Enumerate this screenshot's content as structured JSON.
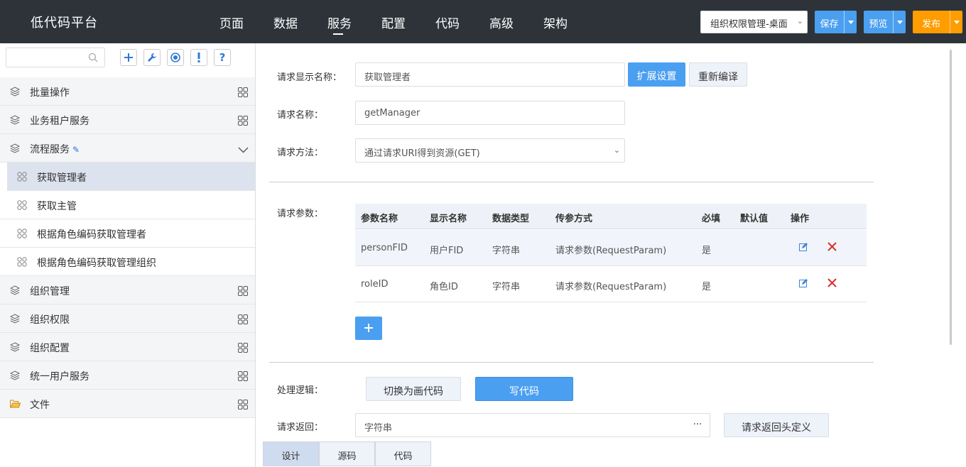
{
  "app": {
    "title": "低代码平台"
  },
  "nav": {
    "items": [
      {
        "label": "页面"
      },
      {
        "label": "数据"
      },
      {
        "label": "服务",
        "active": true
      },
      {
        "label": "配置"
      },
      {
        "label": "代码"
      },
      {
        "label": "高级"
      },
      {
        "label": "架构"
      }
    ]
  },
  "header": {
    "workspace_select": "组织权限管理-桌面",
    "save_label": "保存",
    "preview_label": "预览",
    "publish_label": "发布"
  },
  "sidebar": {
    "search_placeholder": "",
    "tools": [
      {
        "icon": "plus-icon"
      },
      {
        "icon": "wrench-icon"
      },
      {
        "icon": "target-icon"
      },
      {
        "icon": "exclamation-icon"
      },
      {
        "icon": "question-icon"
      }
    ],
    "tree": [
      {
        "label": "批量操作",
        "type": "group"
      },
      {
        "label": "业务租户服务",
        "type": "group"
      },
      {
        "label": "流程服务",
        "type": "group",
        "expanded": true,
        "editable": true
      },
      {
        "label": "获取管理者",
        "type": "child",
        "selected": true
      },
      {
        "label": "获取主管",
        "type": "child"
      },
      {
        "label": "根据角色编码获取管理者",
        "type": "child"
      },
      {
        "label": "根据角色编码获取管理组织",
        "type": "child"
      },
      {
        "label": "组织管理",
        "type": "group"
      },
      {
        "label": "组织权限",
        "type": "group"
      },
      {
        "label": "组织配置",
        "type": "group"
      },
      {
        "label": "统一用户服务",
        "type": "group"
      },
      {
        "label": "文件",
        "type": "folder"
      }
    ]
  },
  "form": {
    "display_name_label": "请求显示名称：",
    "display_name_value": "获取管理者",
    "ext_settings_label": "扩展设置",
    "recompile_label": "重新编译",
    "name_label": "请求名称：",
    "name_value": "getManager",
    "method_label": "请求方法：",
    "method_value": "通过请求URI得到资源(GET)",
    "params_label": "请求参数：",
    "logic_label": "处理逻辑：",
    "switch_visual_label": "切换为画代码",
    "write_code_label": "写代码",
    "return_label": "请求返回：",
    "return_value": "字符串",
    "ellipsis_label": "···",
    "return_header_label": "请求返回头定义"
  },
  "params_table": {
    "columns": [
      "参数名称",
      "显示名称",
      "数据类型",
      "传参方式",
      "必填",
      "默认值",
      "操作"
    ],
    "rows": [
      {
        "name": "personFID",
        "display": "用户FID",
        "type": "字符串",
        "pass": "请求参数(RequestParam)",
        "required": "是",
        "default": ""
      },
      {
        "name": "roleID",
        "display": "角色ID",
        "type": "字符串",
        "pass": "请求参数(RequestParam)",
        "required": "是",
        "default": ""
      }
    ]
  },
  "bottom_tabs": [
    {
      "label": "设计",
      "active": true
    },
    {
      "label": "源码"
    },
    {
      "label": "代码"
    }
  ],
  "colors": {
    "topbar": "#2d3339",
    "primary": "#4b9ff0",
    "publish": "#ff9c00",
    "delete": "#d9302c"
  }
}
